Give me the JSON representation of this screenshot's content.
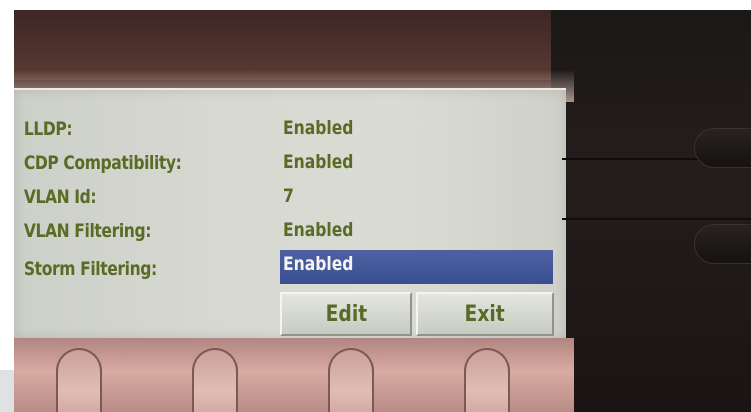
{
  "screen": {
    "settings": [
      {
        "label": "LLDP:",
        "value": "Enabled"
      },
      {
        "label": "CDP Compatibility:",
        "value": "Enabled"
      },
      {
        "label": "VLAN Id:",
        "value": "7"
      },
      {
        "label": "VLAN Filtering:",
        "value": "Enabled"
      },
      {
        "label": "Storm Filtering:",
        "value": "Enabled"
      }
    ],
    "selected_index": 4,
    "softkeys": {
      "edit": "Edit",
      "exit": "Exit"
    }
  },
  "colors": {
    "text": "#5a6b25",
    "selection": "#3f5496",
    "lcd_background": "#d6d8d1"
  }
}
